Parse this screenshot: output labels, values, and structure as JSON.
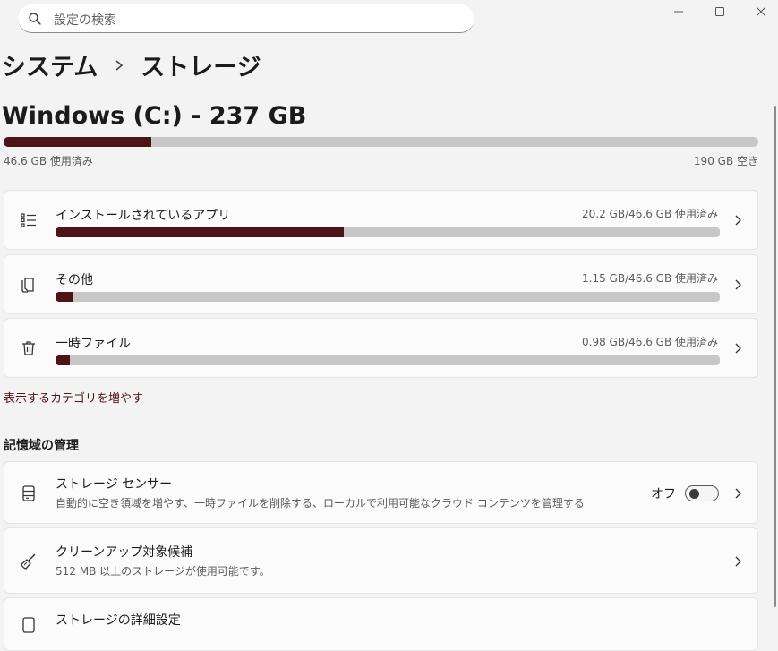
{
  "search": {
    "placeholder": "設定の検索",
    "icon": "search-icon"
  },
  "window_controls": [
    "minimize-icon",
    "maximize-icon",
    "close-icon"
  ],
  "breadcrumb": {
    "parent": "システム",
    "current": "ストレージ"
  },
  "drive": {
    "title": "Windows (C:) - 237 GB",
    "used_fraction": 0.196,
    "used_label": "46.6 GB 使用済み",
    "free_label": "190 GB 空き"
  },
  "categories": [
    {
      "label": "インストールされているアプリ",
      "usage": "20.2 GB/46.6 GB 使用済み",
      "fraction": 0.434,
      "icon": "list-icon"
    },
    {
      "label": "その他",
      "usage": "1.15 GB/46.6 GB 使用済み",
      "fraction": 0.025,
      "icon": "document-icon"
    },
    {
      "label": "一時ファイル",
      "usage": "0.98 GB/46.6 GB 使用済み",
      "fraction": 0.021,
      "icon": "trash-icon"
    }
  ],
  "show_more_label": "表示するカテゴリを増やす",
  "management": {
    "heading": "記憶域の管理",
    "storage_sense": {
      "title": "ストレージ センサー",
      "description": "自動的に空き領域を増やす、一時ファイルを削除する、ローカルで利用可能なクラウド コンテンツを管理する",
      "toggle_label": "オフ",
      "enabled": false,
      "icon": "storage-drive-icon"
    },
    "cleanup": {
      "title": "クリーンアップ対象候補",
      "description": "512 MB 以上のストレージが使用可能です。",
      "icon": "broom-icon"
    },
    "advanced": {
      "title": "ストレージの詳細設定",
      "icon": "storage-settings-icon"
    }
  },
  "colors": {
    "accent": "#4f1418",
    "bar_track": "#c7c7c7",
    "background": "#f3f3f3",
    "card": "#fbfbfb"
  }
}
